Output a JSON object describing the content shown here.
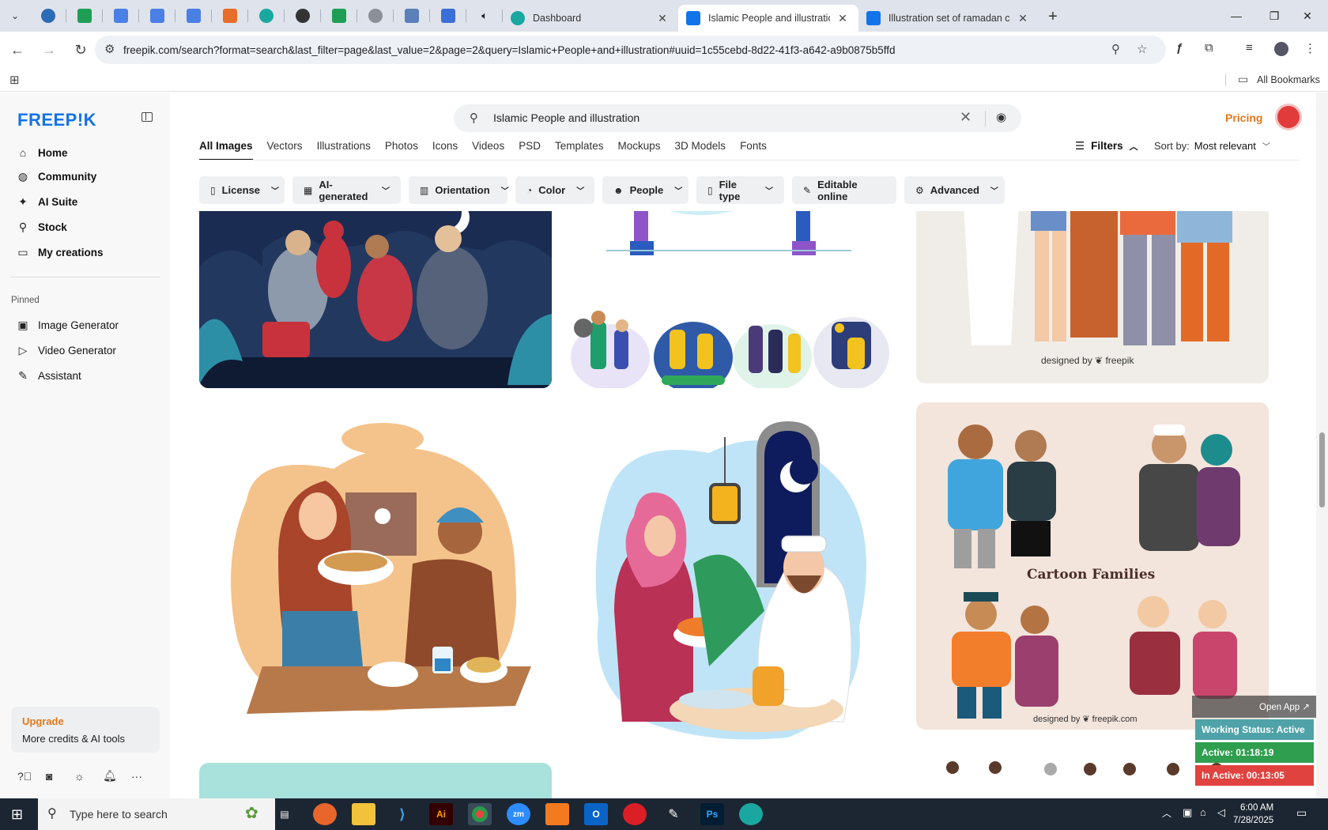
{
  "browser": {
    "tabs": [
      {
        "title": "Dashboard",
        "active": false
      },
      {
        "title": "Islamic People and illustration v",
        "active": true
      },
      {
        "title": "Illustration set of ramadan conc",
        "active": false
      }
    ],
    "new_tab": "+",
    "url": "freepik.com/search?format=search&last_filter=page&last_value=2&page=2&query=Islamic+People+and+illustration#uuid=1c55cebd-8d22-41f3-a642-a9b0875b5ffd",
    "bookmarks_label": "All Bookmarks"
  },
  "sidebar": {
    "logo": "FREEP!K",
    "nav": [
      {
        "label": "Home",
        "icon": "home-icon",
        "glyph": "⌂"
      },
      {
        "label": "Community",
        "icon": "globe-icon",
        "glyph": "◍"
      },
      {
        "label": "AI Suite",
        "icon": "sparkle-icon",
        "glyph": "✦"
      },
      {
        "label": "Stock",
        "icon": "search-icon",
        "glyph": "⚲"
      },
      {
        "label": "My creations",
        "icon": "folder-icon",
        "glyph": "▭"
      }
    ],
    "pinned_label": "Pinned",
    "pinned": [
      {
        "label": "Image Generator",
        "icon": "image-icon",
        "glyph": "▣"
      },
      {
        "label": "Video Generator",
        "icon": "video-icon",
        "glyph": "▷"
      },
      {
        "label": "Assistant",
        "icon": "assistant-icon",
        "glyph": "✎"
      }
    ],
    "upgrade_title": "Upgrade",
    "upgrade_sub": "More credits & AI tools"
  },
  "search": {
    "query": "Islamic People and illustration"
  },
  "header": {
    "pricing": "Pricing"
  },
  "category_tabs": [
    "All Images",
    "Vectors",
    "Illustrations",
    "Photos",
    "Icons",
    "Videos",
    "PSD",
    "Templates",
    "Mockups",
    "3D Models",
    "Fonts"
  ],
  "filters_label": "Filters",
  "sort": {
    "label": "Sort by:",
    "value": "Most relevant"
  },
  "chips": [
    {
      "label": "License",
      "icon": "license-icon",
      "glyph": "▯",
      "dropdown": true
    },
    {
      "label": "AI-generated",
      "icon": "ai-icon",
      "glyph": "▦",
      "dropdown": true
    },
    {
      "label": "Orientation",
      "icon": "orientation-icon",
      "glyph": "▥",
      "dropdown": true
    },
    {
      "label": "Color",
      "icon": "palette-icon",
      "glyph": "◔",
      "dropdown": true
    },
    {
      "label": "People",
      "icon": "people-icon",
      "glyph": "☻",
      "dropdown": true
    },
    {
      "label": "File type",
      "icon": "file-icon",
      "glyph": "▯",
      "dropdown": true
    },
    {
      "label": "Editable online",
      "icon": "pen-icon",
      "glyph": "✎",
      "dropdown": false
    },
    {
      "label": "Advanced",
      "icon": "gear-icon",
      "glyph": "⚙",
      "dropdown": true
    }
  ],
  "results": {
    "watermark_1": "designed by ❦ freepik",
    "cartoon_title": "Cartoon Families",
    "watermark_2": "designed by ❦ freepik.com"
  },
  "tracker": {
    "open_app": "Open App ↗",
    "status": "Working Status: Active",
    "active": "Active: 01:18:19",
    "inactive": "In Active: 00:13:05"
  },
  "taskbar": {
    "search_placeholder": "Type here to search",
    "time": "6:00 AM",
    "date": "7/28/2025"
  },
  "colors": {
    "accent": "#1273eb",
    "pricing": "#e0791b",
    "tracker_status": "#4fa3a8",
    "tracker_active": "#2f9e4f",
    "tracker_inactive": "#e0433f"
  }
}
